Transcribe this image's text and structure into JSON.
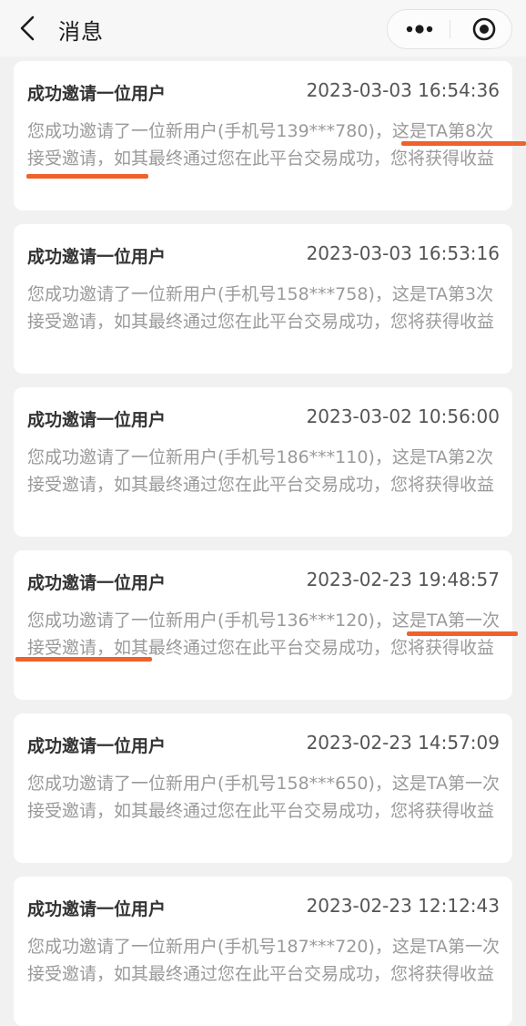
{
  "header": {
    "back_icon": "chevron-left-icon",
    "title": "消息",
    "more_icon": "more-dots-icon",
    "close_icon": "target-close-icon"
  },
  "colors": {
    "background": "#f1f1f1",
    "card": "#ffffff",
    "title_text": "#333333",
    "body_text": "#9a9a9a",
    "annotation": "#f0622a"
  },
  "messages": [
    {
      "title": "成功邀请一位用户",
      "time": "2023-03-03 16:54:36",
      "body": "您成功邀请了一位新用户(手机号139***780)，这是TA第8次接受邀请，如其最终通过您在此平台交易成功，您将获得收益"
    },
    {
      "title": "成功邀请一位用户",
      "time": "2023-03-03 16:53:16",
      "body": "您成功邀请了一位新用户(手机号158***758)，这是TA第3次接受邀请，如其最终通过您在此平台交易成功，您将获得收益"
    },
    {
      "title": "成功邀请一位用户",
      "time": "2023-03-02 10:56:00",
      "body": "您成功邀请了一位新用户(手机号186***110)，这是TA第2次接受邀请，如其最终通过您在此平台交易成功，您将获得收益"
    },
    {
      "title": "成功邀请一位用户",
      "time": "2023-02-23 19:48:57",
      "body": "您成功邀请了一位新用户(手机号136***120)，这是TA第一次接受邀请，如其最终通过您在此平台交易成功，您将获得收益"
    },
    {
      "title": "成功邀请一位用户",
      "time": "2023-02-23 14:57:09",
      "body": "您成功邀请了一位新用户(手机号158***650)，这是TA第一次接受邀请，如其最终通过您在此平台交易成功，您将获得收益"
    },
    {
      "title": "成功邀请一位用户",
      "time": "2023-02-23 12:12:43",
      "body": "您成功邀请了一位新用户(手机号187***720)，这是TA第一次接受邀请，如其最终通过您在此平台交易成功，您将获得收益"
    }
  ]
}
